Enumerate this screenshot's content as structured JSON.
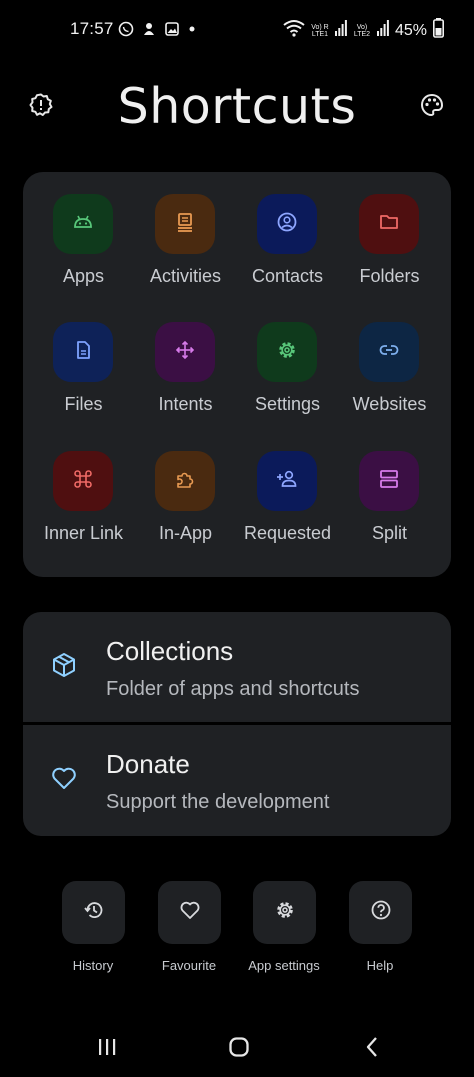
{
  "status_bar": {
    "time": "17:57",
    "battery": "45%",
    "sim1": "Vo) R\nLTE1",
    "sim2": "Vo)\nLTE2"
  },
  "header": {
    "title": "Shortcuts",
    "left_icon": "info-gear-icon",
    "right_icon": "palette-icon"
  },
  "grid": [
    {
      "label": "Apps",
      "icon": "android-icon",
      "bg": "#0f3a1c",
      "fg": "#58c77a"
    },
    {
      "label": "Activities",
      "icon": "activities-icon",
      "bg": "#4a2a10",
      "fg": "#e89a52"
    },
    {
      "label": "Contacts",
      "icon": "contact-icon",
      "bg": "#0b1a5a",
      "fg": "#8ea6ff"
    },
    {
      "label": "Folders",
      "icon": "folder-icon",
      "bg": "#4f0f10",
      "fg": "#ef6a66"
    },
    {
      "label": "Files",
      "icon": "file-icon",
      "bg": "#0e2258",
      "fg": "#7ea3ff"
    },
    {
      "label": "Intents",
      "icon": "intent-icon",
      "bg": "#3b0f44",
      "fg": "#d77bea"
    },
    {
      "label": "Settings",
      "icon": "gear-icon",
      "bg": "#0f3a1c",
      "fg": "#58c77a"
    },
    {
      "label": "Websites",
      "icon": "link-icon",
      "bg": "#0d2644",
      "fg": "#7fb0ee"
    },
    {
      "label": "Inner Link",
      "icon": "command-icon",
      "bg": "#4f0f10",
      "fg": "#ef6a66"
    },
    {
      "label": "In-App",
      "icon": "extension-icon",
      "bg": "#4a2a10",
      "fg": "#e89a52"
    },
    {
      "label": "Requested",
      "icon": "person-add-icon",
      "bg": "#0b1a5a",
      "fg": "#8ea6ff"
    },
    {
      "label": "Split",
      "icon": "split-icon",
      "bg": "#3b0f44",
      "fg": "#d77bea"
    }
  ],
  "list": [
    {
      "title": "Collections",
      "subtitle": "Folder of apps and shortcuts",
      "icon": "cube-icon"
    },
    {
      "title": "Donate",
      "subtitle": "Support the development",
      "icon": "heart-icon"
    }
  ],
  "actions": [
    {
      "label": "History",
      "icon": "history-icon"
    },
    {
      "label": "Favourite",
      "icon": "heart-outline-icon"
    },
    {
      "label": "App settings",
      "icon": "settings-cog-icon"
    },
    {
      "label": "Help",
      "icon": "help-icon"
    }
  ],
  "nav": {
    "recents_icon": "recents-icon",
    "home_icon": "home-icon",
    "back_icon": "back-icon"
  },
  "colors": {
    "background": "#000000",
    "card": "#1f2124",
    "list_icon": "#8fd0ff"
  }
}
